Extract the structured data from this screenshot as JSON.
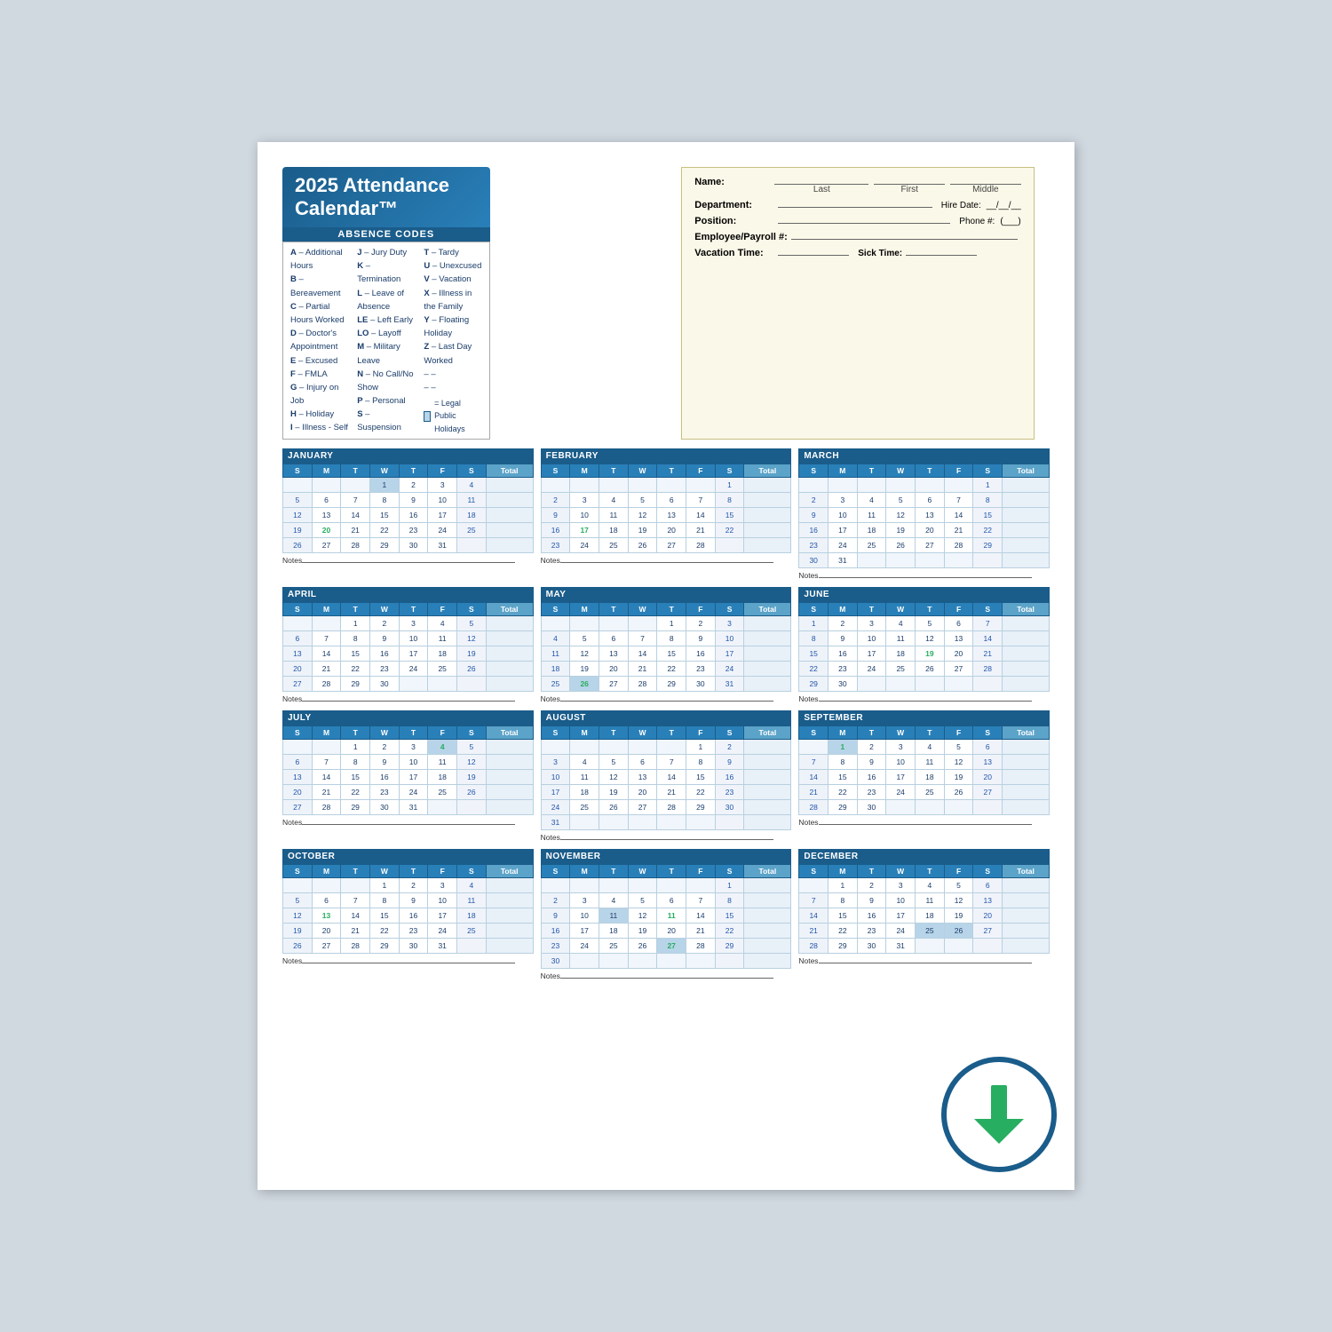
{
  "title": "2025 Attendance Calendar™",
  "absence_header": "ABSENCE CODES",
  "absence_codes_col1": [
    "A – Additional Hours",
    "B – Bereavement",
    "C – Partial Hours Worked",
    "D – Doctor's Appointment",
    "E – Excused",
    "F – FMLA",
    "G – Injury on Job",
    "H – Holiday",
    "I – Illness - Self"
  ],
  "absence_codes_col2": [
    "J – Jury Duty",
    "K – Termination",
    "L – Leave of Absence",
    "LE – Left Early",
    "LO – Layoff",
    "M – Military Leave",
    "N – No Call/No Show",
    "P – Personal",
    "S – Suspension"
  ],
  "absence_codes_col3": [
    "T – Tardy",
    "U – Unexcused",
    "V – Vacation",
    "X – Illness in the Family",
    "Y – Floating Holiday",
    "Z – Last Day Worked",
    "– –",
    "– –"
  ],
  "holiday_note": "= Legal Public Holidays",
  "employee_fields": {
    "name_label": "Name:",
    "last_label": "Last",
    "first_label": "First",
    "middle_label": "Middle",
    "dept_label": "Department:",
    "hire_label": "Hire Date:",
    "position_label": "Position:",
    "phone_label": "Phone #:",
    "payroll_label": "Employee/Payroll #:",
    "vacation_label": "Vacation Time:",
    "sick_label": "Sick Time:"
  },
  "months": [
    {
      "name": "JANUARY",
      "days_header": [
        "S",
        "M",
        "T",
        "W",
        "T",
        "F",
        "S",
        "Total"
      ],
      "weeks": [
        [
          "",
          "",
          "",
          "1",
          "2",
          "3",
          "4",
          ""
        ],
        [
          "5",
          "6",
          "7",
          "8",
          "9",
          "10",
          "11",
          ""
        ],
        [
          "12",
          "13",
          "14",
          "15",
          "16",
          "17",
          "18",
          ""
        ],
        [
          "19",
          "20",
          "21",
          "22",
          "23",
          "24",
          "25",
          ""
        ],
        [
          "26",
          "27",
          "28",
          "29",
          "30",
          "31",
          "",
          ""
        ]
      ],
      "special": {
        "row": 3,
        "col": 1,
        "class": "green-date",
        "val": "20"
      },
      "holiday_cells": [
        {
          "row": 0,
          "col": 3
        }
      ]
    },
    {
      "name": "FEBRUARY",
      "weeks": [
        [
          "",
          "",
          "",
          "",
          "",
          "",
          "1",
          ""
        ],
        [
          "2",
          "3",
          "4",
          "5",
          "6",
          "7",
          "8",
          ""
        ],
        [
          "9",
          "10",
          "11",
          "12",
          "13",
          "14",
          "15",
          ""
        ],
        [
          "16",
          "17",
          "18",
          "19",
          "20",
          "21",
          "22",
          ""
        ],
        [
          "23",
          "24",
          "25",
          "26",
          "27",
          "28",
          "",
          ""
        ]
      ],
      "special": {
        "row": 2,
        "col": 1,
        "class": "green-date",
        "val": "17"
      },
      "holiday_cells": []
    },
    {
      "name": "MARCH",
      "weeks": [
        [
          "",
          "",
          "",
          "",
          "",
          "",
          "1",
          ""
        ],
        [
          "2",
          "3",
          "4",
          "5",
          "6",
          "7",
          "8",
          ""
        ],
        [
          "9",
          "10",
          "11",
          "12",
          "13",
          "14",
          "15",
          ""
        ],
        [
          "16",
          "17",
          "18",
          "19",
          "20",
          "21",
          "22",
          ""
        ],
        [
          "23",
          "24",
          "25",
          "26",
          "27",
          "28",
          "29",
          ""
        ],
        [
          "30",
          "31",
          "",
          "",
          "",
          "",
          "",
          ""
        ]
      ],
      "holiday_cells": []
    },
    {
      "name": "APRIL",
      "weeks": [
        [
          "",
          "",
          "1",
          "2",
          "3",
          "4",
          "5",
          ""
        ],
        [
          "6",
          "7",
          "8",
          "9",
          "10",
          "11",
          "12",
          ""
        ],
        [
          "13",
          "14",
          "15",
          "16",
          "17",
          "18",
          "19",
          ""
        ],
        [
          "20",
          "21",
          "22",
          "23",
          "24",
          "25",
          "26",
          ""
        ],
        [
          "27",
          "28",
          "29",
          "30",
          "",
          "",
          "",
          ""
        ]
      ],
      "holiday_cells": []
    },
    {
      "name": "MAY",
      "weeks": [
        [
          "",
          "",
          "",
          "",
          "1",
          "2",
          "3",
          ""
        ],
        [
          "4",
          "5",
          "6",
          "7",
          "8",
          "9",
          "10",
          ""
        ],
        [
          "11",
          "12",
          "13",
          "14",
          "15",
          "16",
          "17",
          ""
        ],
        [
          "18",
          "19",
          "20",
          "21",
          "22",
          "23",
          "24",
          ""
        ],
        [
          "25",
          "26",
          "27",
          "28",
          "29",
          "30",
          "31",
          ""
        ]
      ],
      "special": {
        "row": 4,
        "col": 1,
        "class": "green-date",
        "val": "26"
      },
      "holiday_cells": [
        {
          "row": 4,
          "col": 1
        }
      ]
    },
    {
      "name": "JUNE",
      "weeks": [
        [
          "1",
          "2",
          "3",
          "4",
          "5",
          "6",
          "7",
          ""
        ],
        [
          "8",
          "9",
          "10",
          "11",
          "12",
          "13",
          "14",
          ""
        ],
        [
          "15",
          "16",
          "17",
          "18",
          "19",
          "20",
          "21",
          ""
        ],
        [
          "22",
          "23",
          "24",
          "25",
          "26",
          "27",
          "28",
          ""
        ],
        [
          "29",
          "30",
          "",
          "",
          "",
          "",
          "",
          ""
        ]
      ],
      "special": {
        "row": 2,
        "col": 4,
        "class": "green-date",
        "val": "19"
      },
      "holiday_cells": []
    },
    {
      "name": "JULY",
      "weeks": [
        [
          "",
          "",
          "1",
          "2",
          "3",
          "4",
          "5",
          ""
        ],
        [
          "6",
          "7",
          "8",
          "9",
          "10",
          "11",
          "12",
          ""
        ],
        [
          "13",
          "14",
          "15",
          "16",
          "17",
          "18",
          "19",
          ""
        ],
        [
          "20",
          "21",
          "22",
          "23",
          "24",
          "25",
          "26",
          ""
        ],
        [
          "27",
          "28",
          "29",
          "30",
          "31",
          "",
          "",
          ""
        ]
      ],
      "special": {
        "row": 0,
        "col": 5,
        "class": "green-date",
        "val": "4"
      },
      "holiday_cells": [
        {
          "row": 0,
          "col": 5
        }
      ]
    },
    {
      "name": "AUGUST",
      "weeks": [
        [
          "",
          "",
          "",
          "",
          "",
          "1",
          "2",
          ""
        ],
        [
          "3",
          "4",
          "5",
          "6",
          "7",
          "8",
          "9",
          ""
        ],
        [
          "10",
          "11",
          "12",
          "13",
          "14",
          "15",
          "16",
          ""
        ],
        [
          "17",
          "18",
          "19",
          "20",
          "21",
          "22",
          "23",
          ""
        ],
        [
          "24",
          "25",
          "26",
          "27",
          "28",
          "29",
          "30",
          ""
        ],
        [
          "31",
          "",
          "",
          "",
          "",
          "",
          "",
          ""
        ]
      ],
      "holiday_cells": []
    },
    {
      "name": "SEPTEMBER",
      "weeks": [
        [
          "",
          "1",
          "2",
          "3",
          "4",
          "5",
          "6",
          ""
        ],
        [
          "7",
          "8",
          "9",
          "10",
          "11",
          "12",
          "13",
          ""
        ],
        [
          "14",
          "15",
          "16",
          "17",
          "18",
          "19",
          "20",
          ""
        ],
        [
          "21",
          "22",
          "23",
          "24",
          "25",
          "26",
          "27",
          ""
        ],
        [
          "28",
          "29",
          "30",
          "",
          "",
          "",
          "",
          ""
        ]
      ],
      "special": {
        "row": 0,
        "col": 1,
        "class": "green-date",
        "val": "1"
      },
      "holiday_cells": [
        {
          "row": 0,
          "col": 1
        }
      ]
    },
    {
      "name": "OCTOBER",
      "weeks": [
        [
          "",
          "",
          "",
          "1",
          "2",
          "3",
          "4",
          ""
        ],
        [
          "5",
          "6",
          "7",
          "8",
          "9",
          "10",
          "11",
          ""
        ],
        [
          "12",
          "13",
          "14",
          "15",
          "16",
          "17",
          "18",
          ""
        ],
        [
          "19",
          "20",
          "21",
          "22",
          "23",
          "24",
          "25",
          ""
        ],
        [
          "26",
          "27",
          "28",
          "29",
          "30",
          "31",
          "",
          ""
        ]
      ],
      "special": {
        "row": 2,
        "col": 1,
        "class": "green-date",
        "val": "13"
      },
      "holiday_cells": []
    },
    {
      "name": "NOVEMBER",
      "weeks": [
        [
          "",
          "",
          "",
          "",
          "",
          "",
          "1",
          ""
        ],
        [
          "2",
          "3",
          "4",
          "5",
          "6",
          "7",
          "8",
          ""
        ],
        [
          "9",
          "10",
          "11",
          "12",
          "13",
          "14",
          "15",
          ""
        ],
        [
          "16",
          "17",
          "18",
          "19",
          "20",
          "21",
          "22",
          ""
        ],
        [
          "23",
          "24",
          "25",
          "26",
          "27",
          "28",
          "29",
          ""
        ],
        [
          "30",
          "",
          "",
          "",
          "",
          "",
          "",
          ""
        ]
      ],
      "special": {
        "row": 4,
        "col": 4,
        "class": "green-date",
        "val": "27"
      },
      "holiday_cells": [
        {
          "row": 2,
          "col": 2
        },
        {
          "row": 4,
          "col": 4
        }
      ]
    },
    {
      "name": "DECEMBER",
      "weeks": [
        [
          "",
          "1",
          "2",
          "3",
          "4",
          "5",
          "6",
          ""
        ],
        [
          "7",
          "8",
          "9",
          "10",
          "",
          "",
          "",
          ""
        ],
        [
          "14",
          "15",
          "16",
          "17",
          "",
          "",
          "",
          ""
        ],
        [
          "21",
          "22",
          "23",
          "24",
          "",
          "",
          "",
          ""
        ],
        [
          "28",
          "29",
          "30",
          "31",
          "",
          "",
          "",
          ""
        ]
      ],
      "holiday_cells": [
        {
          "row": 3,
          "col": 4
        },
        {
          "row": 3,
          "col": 5
        }
      ],
      "overlay": true
    }
  ],
  "notes_label": "Notes"
}
